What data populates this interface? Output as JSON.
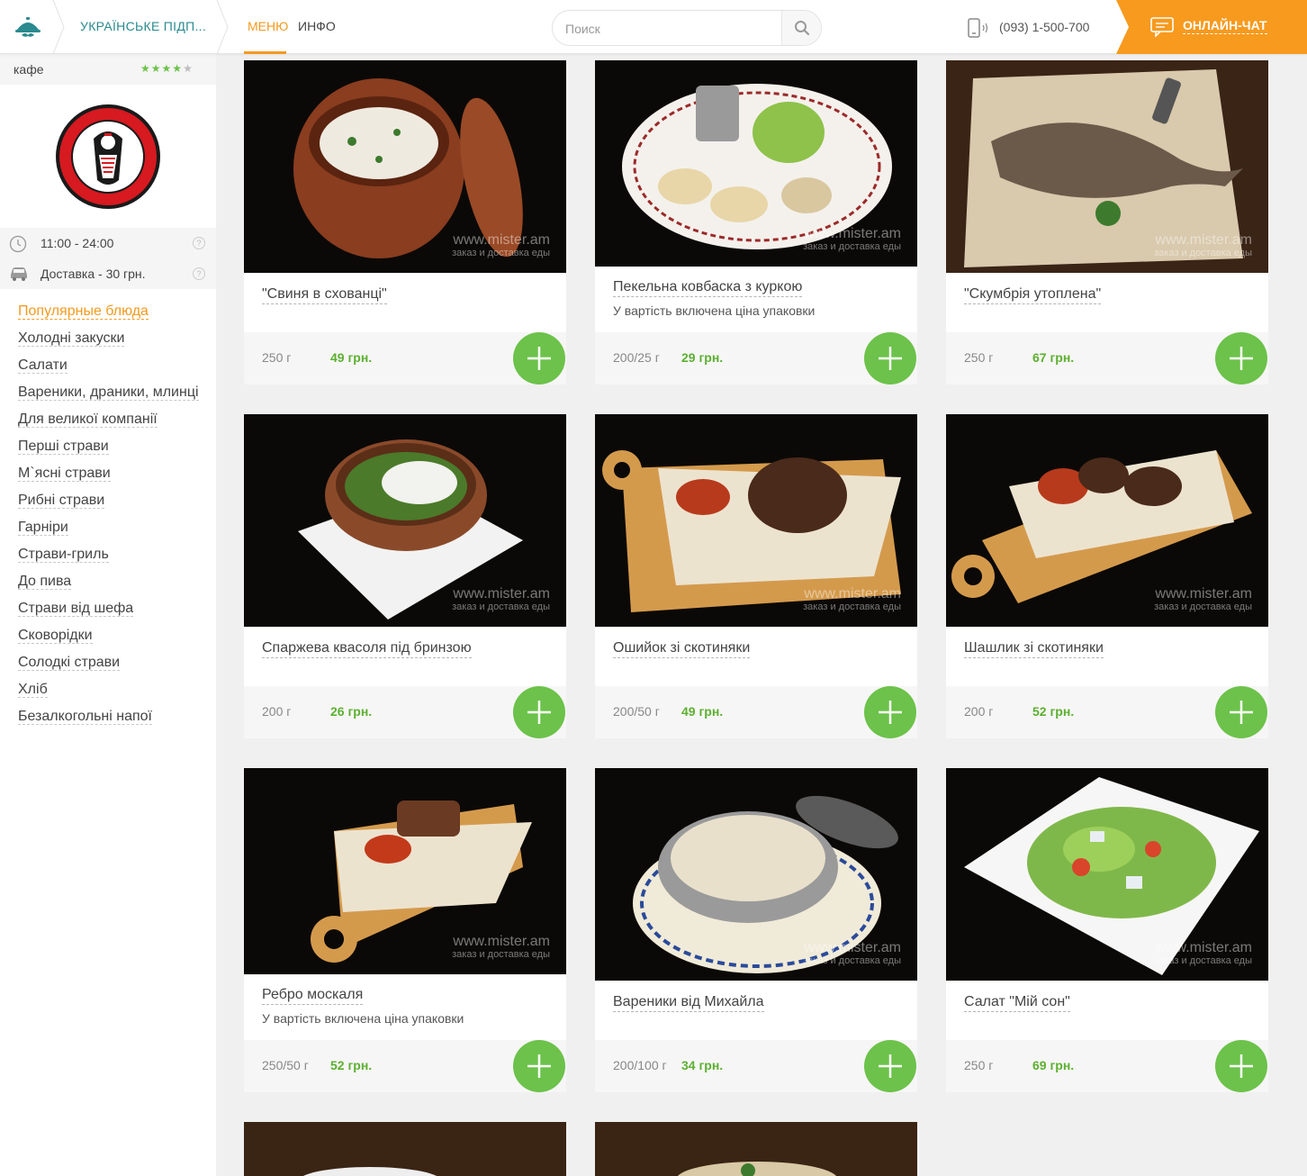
{
  "header": {
    "restaurant_name": "УКРАЇНСЬКЕ ПІДП...",
    "nav": {
      "menu": "МЕНЮ",
      "info": "ИНФО"
    },
    "search_placeholder": "Поиск",
    "phone": "(093) 1-500-700",
    "chat_label": "ОНЛАЙН-ЧАТ",
    "accent_color": "#f79a1e"
  },
  "sidebar": {
    "type": "кафе",
    "rating": 4,
    "rating_max": 5,
    "hours": "11:00 - 24:00",
    "delivery": "Доставка - 30 грн.",
    "help": "?",
    "categories": [
      "Популярные блюда",
      "Холодні закуски",
      "Салати",
      "Вареники, драники, млинці",
      "Для великої компанії",
      "Перші страви",
      "М`ясні страви",
      "Рибні страви",
      "Гарніри",
      "Страви-гриль",
      "До пива",
      "Страви від шефа",
      "Сковорідки",
      "Солодкі страви",
      "Хліб",
      "Безалкогольні напої"
    ],
    "active_category": 0
  },
  "watermark": {
    "site": "www.mister.am",
    "tagline": "заказ и доставка еды"
  },
  "dishes": [
    {
      "name": "\"Свиня в схованці\"",
      "note": "",
      "weight": "250 г",
      "price": "49 грн."
    },
    {
      "name": "Пекельна ковбаска з куркою",
      "note": "У вартість включена ціна упаковки",
      "weight": "200/25 г",
      "price": "29 грн."
    },
    {
      "name": "\"Скумбрія утоплена\"",
      "note": "",
      "weight": "250 г",
      "price": "67 грн."
    },
    {
      "name": "Спаржева квасоля під бринзою",
      "note": "",
      "weight": "200 г",
      "price": "26 грн."
    },
    {
      "name": "Ошийок зі скотиняки",
      "note": "",
      "weight": "200/50 г",
      "price": "49 грн."
    },
    {
      "name": "Шашлик зі скотиняки",
      "note": "",
      "weight": "200 г",
      "price": "52 грн."
    },
    {
      "name": "Ребро москаля",
      "note": "У вартість включена ціна упаковки",
      "weight": "250/50 г",
      "price": "52 грн."
    },
    {
      "name": "Вареники від Михайла",
      "note": "",
      "weight": "200/100 г",
      "price": "34 грн."
    },
    {
      "name": "Салат \"Мій сон\"",
      "note": "",
      "weight": "250 г",
      "price": "69 грн."
    }
  ]
}
